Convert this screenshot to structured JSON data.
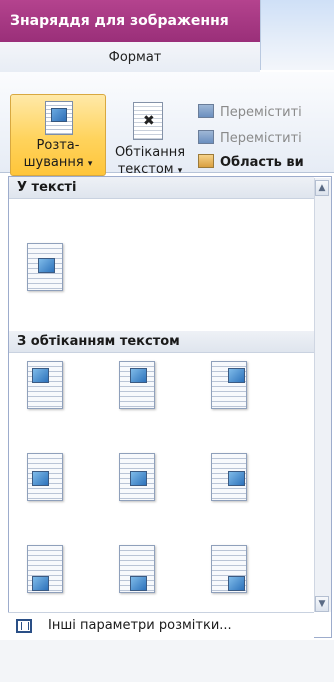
{
  "context_tab": {
    "title": "Знаряддя для зображення"
  },
  "tabs": [
    {
      "label": "Формат"
    }
  ],
  "ribbon": {
    "position_button": {
      "line1": "Розта-",
      "line2": "шування",
      "arrow": "▾"
    },
    "wrap_button": {
      "line1": "Обтікання",
      "line2": "текстом",
      "arrow": "▾"
    },
    "small_items": [
      {
        "label": "Переміститі"
      },
      {
        "label": "Переміститі"
      },
      {
        "label": "Область ви"
      }
    ]
  },
  "gallery": {
    "section_inline": "У тексті",
    "section_wrap": "З обтіканням текстом",
    "scroll_up": "▲",
    "scroll_down": "▼"
  },
  "footer": {
    "label": "Інші параметри розмітки..."
  }
}
